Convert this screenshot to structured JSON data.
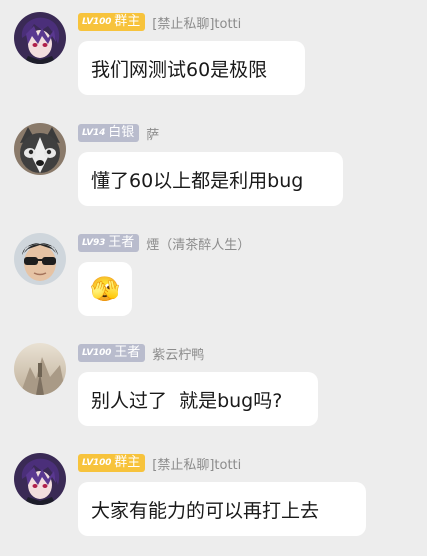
{
  "messages": [
    {
      "avatar": "avatar-anime-purple-hair",
      "level": "LV100",
      "rank": "群主",
      "sender": "[禁止私聊]totti",
      "text": "我们网测试60是极限"
    },
    {
      "avatar": "avatar-husky-dog",
      "level": "LV14",
      "rank": "白银",
      "sender": "萨",
      "text": "懂了60以上都是利用bug"
    },
    {
      "avatar": "avatar-sunglasses-man",
      "level": "LV93",
      "rank": "王者",
      "sender": "煙（清茶醉人生）",
      "text": "🫣"
    },
    {
      "avatar": "avatar-misty-landscape",
      "level": "LV100",
      "rank": "王者",
      "sender": "紫云柠鸭",
      "text": "别人过了  就是bug吗?"
    },
    {
      "avatar": "avatar-anime-purple-hair",
      "level": "LV100",
      "rank": "群主",
      "sender": "[禁止私聊]totti",
      "text": "大家有能力的可以再打上去"
    }
  ],
  "colors": {
    "owner_badge": "#f7c33c",
    "member_badge": "#b9bccd",
    "background": "#ededed",
    "bubble": "#ffffff"
  }
}
